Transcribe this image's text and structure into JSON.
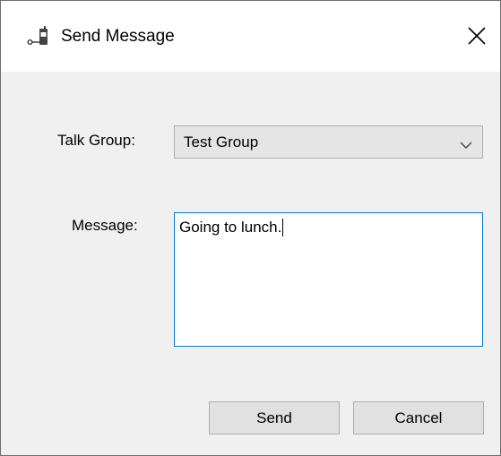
{
  "window": {
    "title": "Send Message",
    "icon": "radio-icon",
    "close_icon": "close-icon"
  },
  "form": {
    "talk_group_label": "Talk Group:",
    "talk_group_selected": "Test Group",
    "message_label": "Message:",
    "message_value": "Going to lunch."
  },
  "buttons": {
    "send_label": "Send",
    "cancel_label": "Cancel"
  },
  "colors": {
    "focus_border": "#0078d7",
    "dialog_background": "#f0f0f0",
    "button_background": "#e1e1e1"
  }
}
